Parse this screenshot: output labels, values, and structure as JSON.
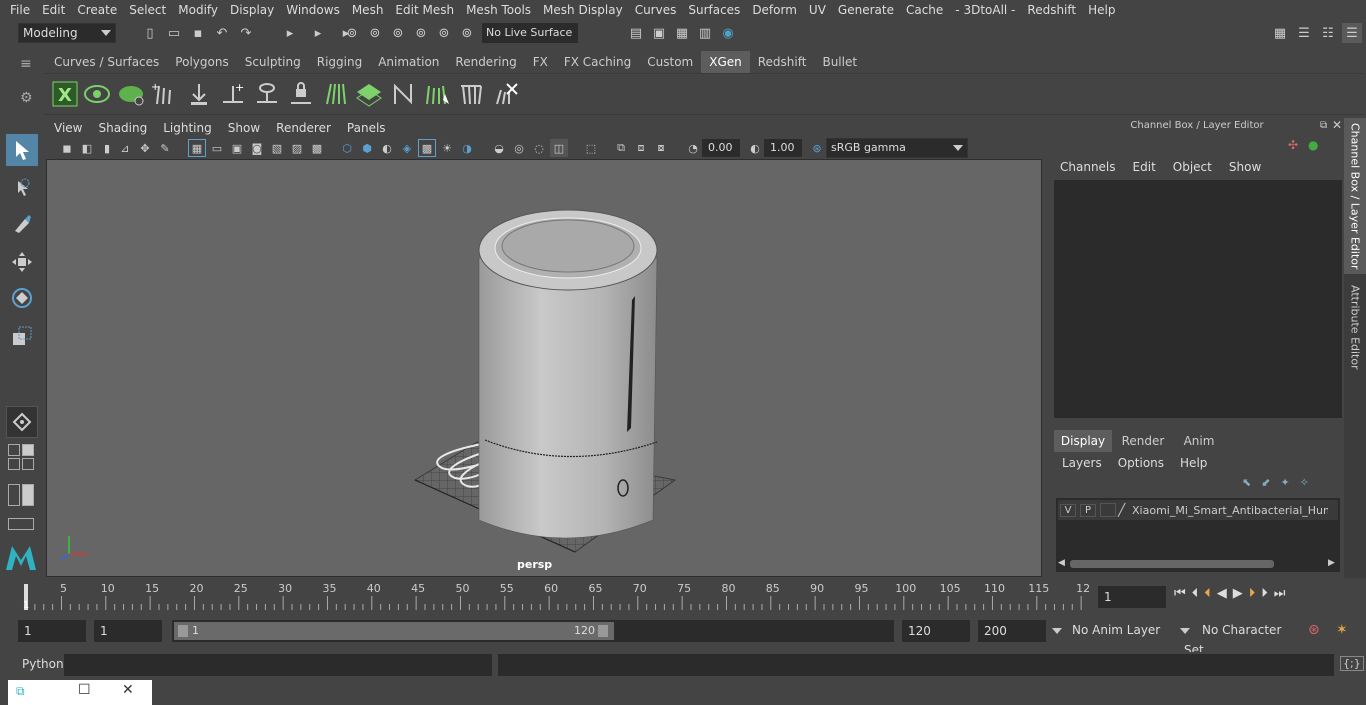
{
  "menubar": [
    "File",
    "Edit",
    "Create",
    "Select",
    "Modify",
    "Display",
    "Windows",
    "Mesh",
    "Edit Mesh",
    "Mesh Tools",
    "Mesh Display",
    "Curves",
    "Surfaces",
    "Deform",
    "UV",
    "Generate",
    "Cache",
    "- 3DtoAll -",
    "Redshift",
    "Help"
  ],
  "status": {
    "mode": "Modeling",
    "live_surface": "No Live Surface"
  },
  "shelf_tabs": [
    "Curves / Surfaces",
    "Polygons",
    "Sculpting",
    "Rigging",
    "Animation",
    "Rendering",
    "FX",
    "FX Caching",
    "Custom",
    "XGen",
    "Redshift",
    "Bullet"
  ],
  "shelf_active": "XGen",
  "panel_menu": [
    "View",
    "Shading",
    "Lighting",
    "Show",
    "Renderer",
    "Panels"
  ],
  "panel_toolbar": {
    "exposure": "0.00",
    "gamma": "1.00",
    "colorspace": "sRGB gamma"
  },
  "viewport": {
    "camera": "persp"
  },
  "channel_box": {
    "title": "Channel Box / Layer Editor",
    "menus": [
      "Channels",
      "Edit",
      "Object",
      "Show"
    ]
  },
  "layer_editor": {
    "tabs": [
      "Display",
      "Render",
      "Anim"
    ],
    "active_tab": "Display",
    "menus": [
      "Layers",
      "Options",
      "Help"
    ],
    "layer": {
      "v": "V",
      "p": "P",
      "name": "Xiaomi_Mi_Smart_Antibacterial_Humidifier"
    }
  },
  "side_tabs": [
    "Channel Box / Layer Editor",
    "Attribute Editor"
  ],
  "timeline": {
    "ticks": [
      "5",
      "10",
      "15",
      "20",
      "25",
      "30",
      "35",
      "40",
      "45",
      "50",
      "55",
      "60",
      "65",
      "70",
      "75",
      "80",
      "85",
      "90",
      "95",
      "100",
      "105",
      "110",
      "115",
      "12"
    ],
    "current_frame_marker": "1",
    "current_frame": "1"
  },
  "range": {
    "start": "1",
    "playback_start": "1",
    "slider_start": "1",
    "slider_end": "120",
    "playback_end": "120",
    "end": "200",
    "anim_layer": "No Anim Layer",
    "character_set": "No Character Set"
  },
  "cmdline": {
    "label": "Python"
  },
  "colors": {
    "bg": "#444444",
    "viewport": "#666666",
    "accent": "#5285a6",
    "field": "#2b2b2b"
  }
}
